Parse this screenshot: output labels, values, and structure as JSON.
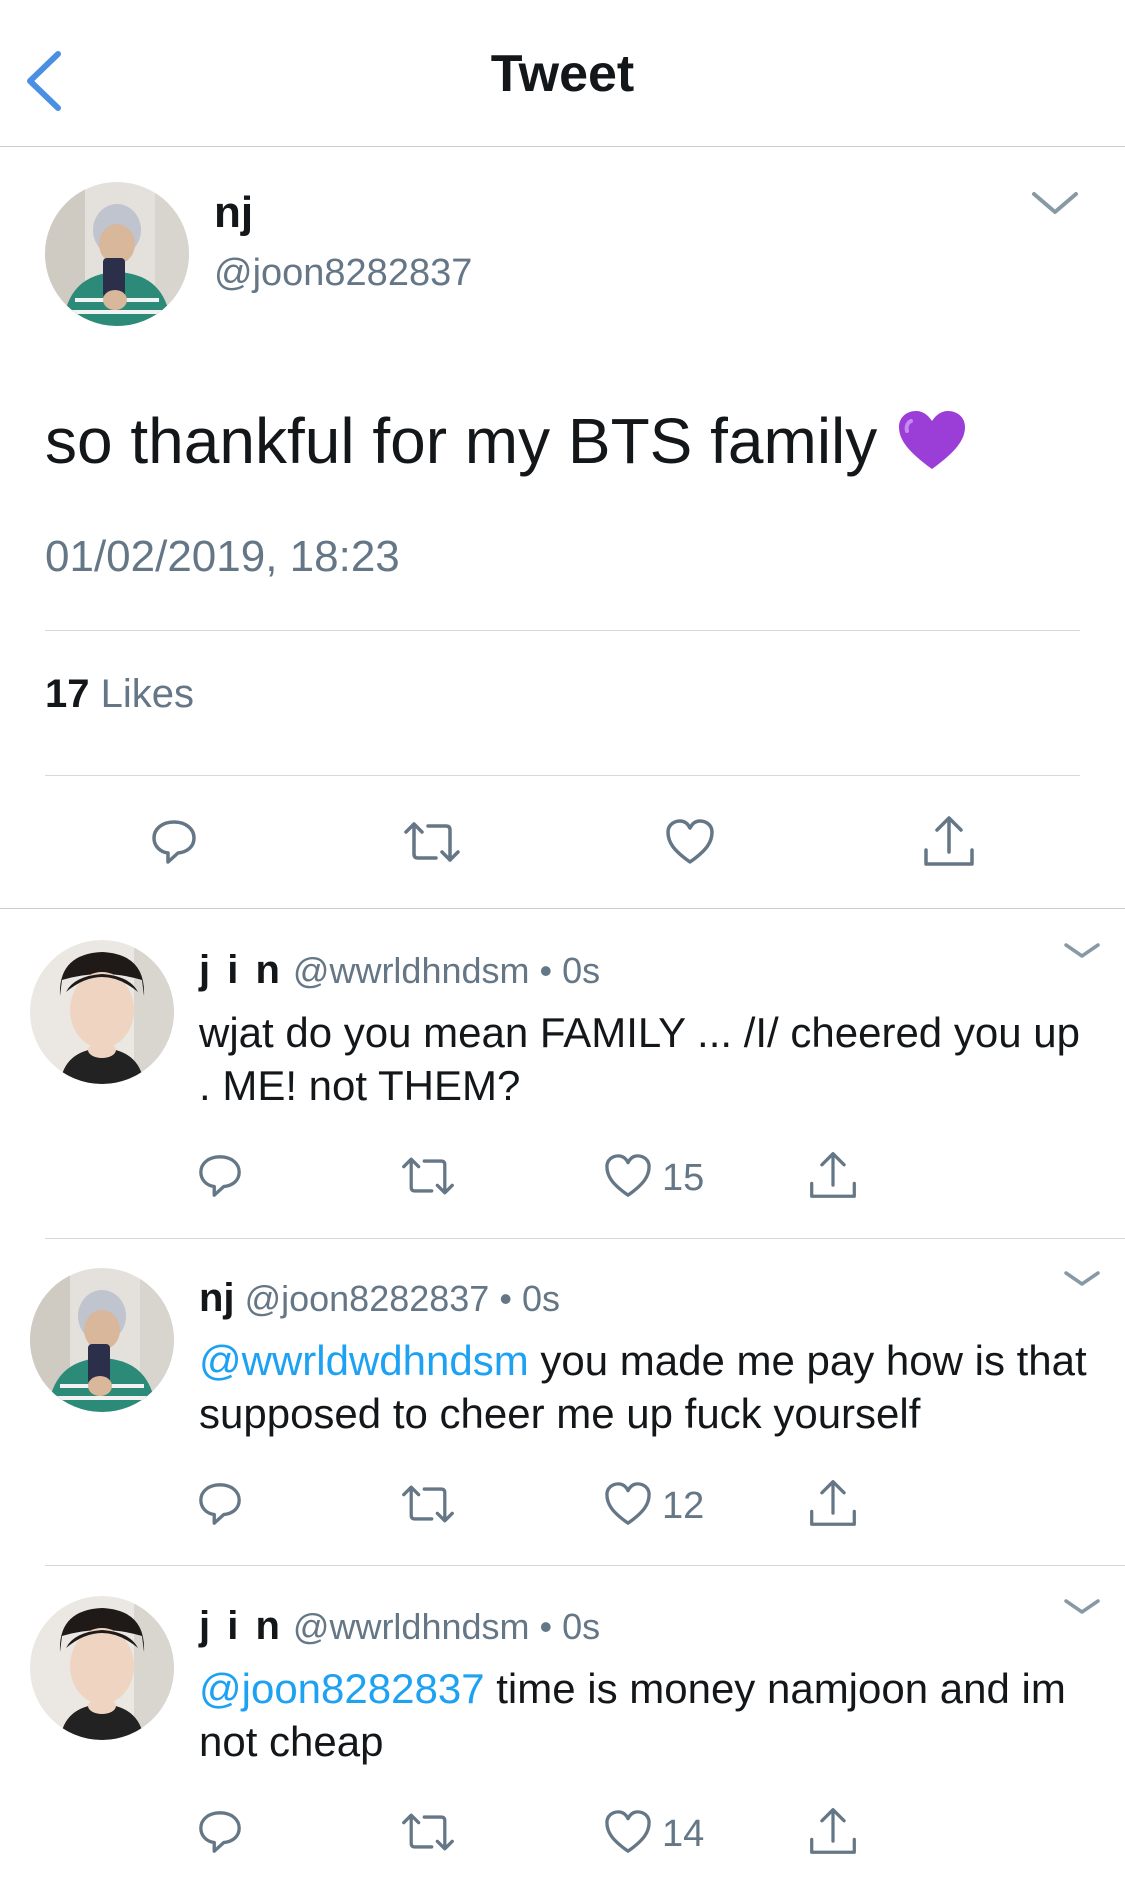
{
  "nav": {
    "title": "Tweet"
  },
  "main_tweet": {
    "name": "nj",
    "handle": "@joon8282837",
    "text": "so thankful for my BTS family",
    "timestamp": "01/02/2019, 18:23",
    "likes_count": "17",
    "likes_label": "Likes"
  },
  "replies": [
    {
      "name": "j i n",
      "handle": "@wwrldhndsm",
      "time": "• 0s",
      "mention": "",
      "text": "wjat do you mean FAMILY ... /I/ cheered you up . ME! not THEM?",
      "likes": "15"
    },
    {
      "name": "nj",
      "handle": "@joon8282837",
      "time": "• 0s",
      "mention": "@wwrldwdhndsm",
      "text": " you made me pay how is that supposed to cheer me up fuck yourself",
      "likes": "12"
    },
    {
      "name": "j i n",
      "handle": "@wwrldhndsm",
      "time": "• 0s",
      "mention": "@joon8282837",
      "text": " time is money namjoon and im not cheap",
      "likes": "14"
    }
  ]
}
